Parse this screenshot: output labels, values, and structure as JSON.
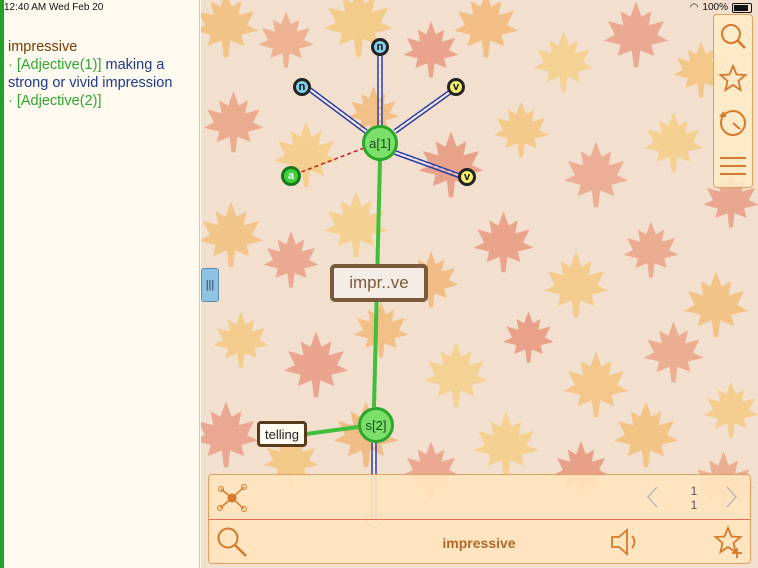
{
  "status_bar": {
    "time": "12:40 AM  Wed Feb 20",
    "battery": "100%"
  },
  "definition": {
    "word": "impressive",
    "senses": [
      {
        "pos": "· [Adjective(1)]",
        "gloss": " making a strong or vivid impression"
      },
      {
        "pos": "· [Adjective(2)]",
        "gloss": ""
      }
    ]
  },
  "graph": {
    "center_label": "impr..ve",
    "nodes": {
      "a1": "a[1]",
      "s2": "s[2]",
      "n_top": "n",
      "n_left": "n",
      "v_upper": "v",
      "v_lower": "v",
      "a_left": "a"
    },
    "related_word": "telling"
  },
  "bottom_bar": {
    "current_word": "impressive",
    "page_current": "1",
    "page_total": "1"
  },
  "colors": {
    "accent_green": "#22a02a",
    "link_blue": "#1e3a8a",
    "toolbar_orange": "#e08a3a"
  }
}
